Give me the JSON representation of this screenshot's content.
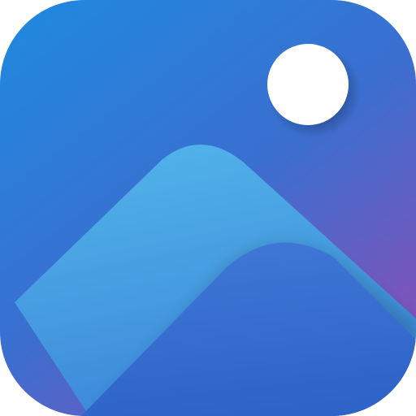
{
  "icon": {
    "name": "photos-app-icon",
    "shape": "rounded-square",
    "glyph": "mountain-with-sun",
    "colors": {
      "background_top": "#1F8AE0",
      "background_mid": "#3A6FD0",
      "background_bottom": "#8552B8",
      "mountain_back_top": "#52B4EA",
      "mountain_back_bottom": "#3B86D8",
      "mountain_front_top": "#3F78D6",
      "mountain_front_bottom": "#2E63C8",
      "sun": "#FFFFFF"
    }
  }
}
